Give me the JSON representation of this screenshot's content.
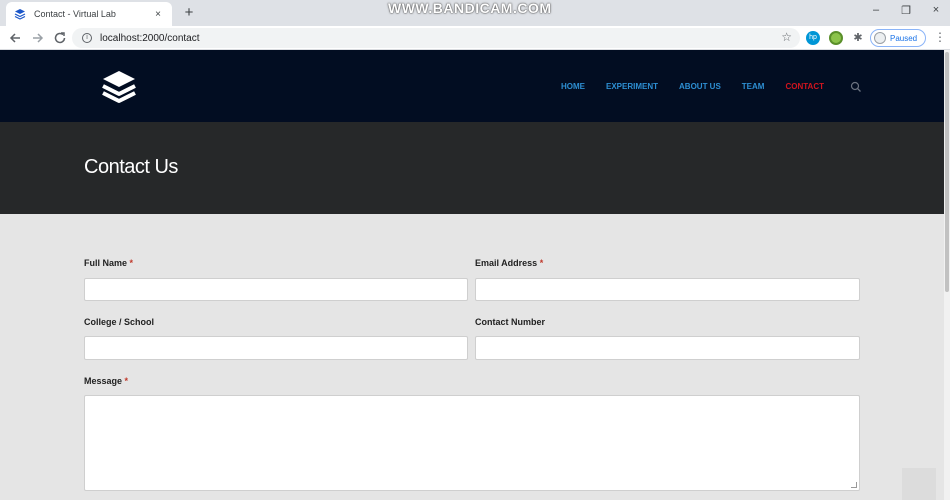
{
  "browser": {
    "tab_title": "Contact - Virtual Lab",
    "tab_close": "×",
    "new_tab": "+",
    "url": "localhost:2000/contact",
    "profile_status": "Paused",
    "watermark": "WWW.BANDICAM.COM",
    "window_controls": [
      "–",
      "❐",
      "×"
    ]
  },
  "site": {
    "nav": [
      "HOME",
      "EXPERIMENT",
      "ABOUT US",
      "TEAM",
      "CONTACT"
    ],
    "active_nav": "CONTACT",
    "page_title": "Contact Us"
  },
  "form": {
    "full_name_label": "Full Name",
    "email_label": "Email Address",
    "college_label": "College / School",
    "contact_label": "Contact Number",
    "message_label": "Message",
    "required_mark": "*",
    "full_name_value": "",
    "email_value": "",
    "college_value": "",
    "contact_value": "",
    "message_value": ""
  },
  "colors": {
    "header_bg": "#020d22",
    "nav_link": "#2d8fd3",
    "nav_active": "#d0141e",
    "hero_bg": "#262829",
    "page_bg": "#e5e5e5"
  },
  "icons": [
    "layers-icon",
    "info-icon",
    "star-icon",
    "search-icon",
    "extensions-icon",
    "back-icon",
    "forward-icon",
    "reload-icon",
    "more-icon"
  ]
}
